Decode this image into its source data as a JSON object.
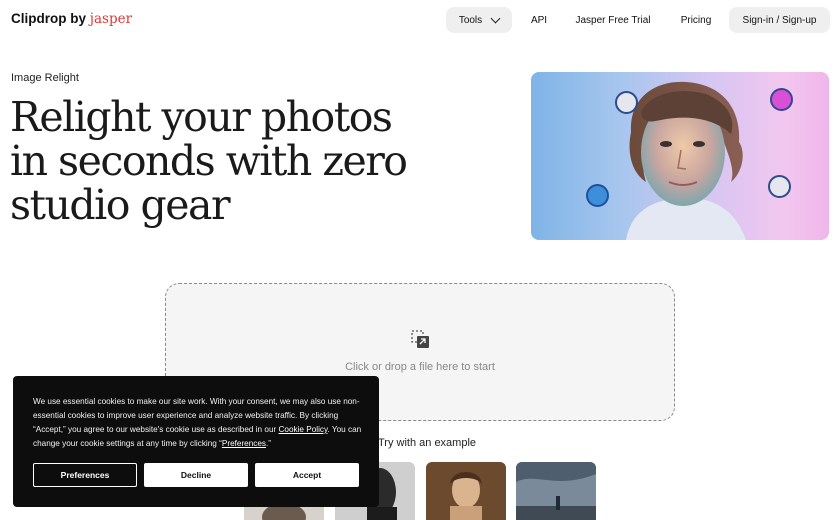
{
  "header": {
    "brand_name": "Clipdrop",
    "brand_by": "by",
    "brand_partner": "jasper",
    "nav": {
      "tools": "Tools",
      "api": "API",
      "free_trial": "Jasper Free Trial",
      "pricing": "Pricing",
      "sign_in": "Sign-in / Sign-up"
    }
  },
  "hero": {
    "eyebrow": "Image Relight",
    "headline": "Relight your photos in seconds with zero studio gear"
  },
  "upload": {
    "prompt": "Click or drop a file here to start",
    "examples_label": "Try with an example"
  },
  "cookie_banner": {
    "text_before_policy": "We use essential cookies to make our site work. With your consent, we may also use non-essential cookies to improve user experience and analyze website traffic. By clicking “Accept,” you agree to our website's cookie use as described in our ",
    "policy_link": "Cookie Policy",
    "text_after_policy": ". You can change your cookie settings at any time by clicking “",
    "preferences_link": "Preferences",
    "text_end": ".”",
    "buttons": {
      "preferences": "Preferences",
      "decline": "Decline",
      "accept": "Accept"
    }
  },
  "colors": {
    "brand_partner": "#e3342f",
    "button_bg": "#efefef",
    "banner_bg": "#0d0d0d"
  }
}
